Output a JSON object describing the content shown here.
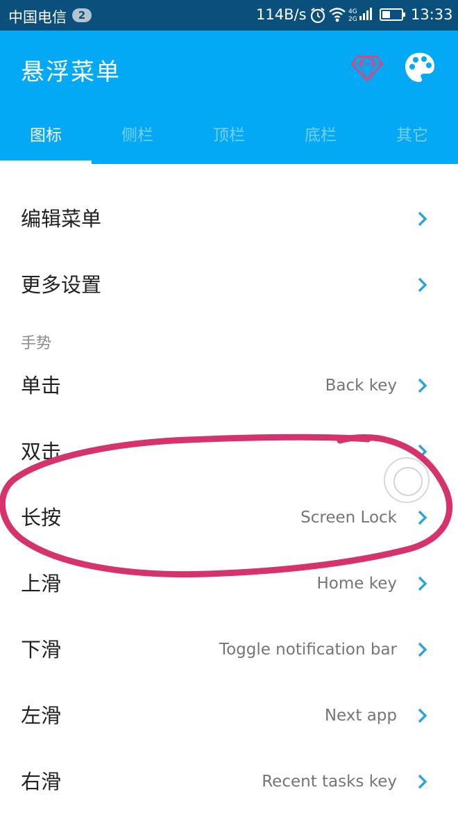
{
  "status_bar": {
    "carrier": "中国电信",
    "notification_count": "2",
    "net_speed": "114B/s",
    "time": "13:33"
  },
  "app_bar": {
    "title": "悬浮菜单",
    "tabs": [
      "图标",
      "侧栏",
      "顶栏",
      "底栏",
      "其它"
    ],
    "active_tab": "图标"
  },
  "menu": {
    "edit_menu": "编辑菜单",
    "more_settings": "更多设置"
  },
  "gestures": {
    "section_title": "手势",
    "items": [
      {
        "label": "单击",
        "value": "Back key"
      },
      {
        "label": "双击",
        "value": ""
      },
      {
        "label": "长按",
        "value": "Screen Lock"
      },
      {
        "label": "上滑",
        "value": "Home key"
      },
      {
        "label": "下滑",
        "value": "Toggle notification bar"
      },
      {
        "label": "左滑",
        "value": "Next app"
      },
      {
        "label": "右滑",
        "value": "Recent tasks key"
      }
    ]
  },
  "icons": {
    "diamond": "diamond-icon",
    "palette": "palette-icon",
    "chevron": "chevron-right-icon"
  },
  "colors": {
    "status_bar": "#0b4f7c",
    "app_bar": "#03a9f4",
    "chevron": "#2aa4e0",
    "annotation": "#d6336c",
    "diamond": "#e0457a"
  }
}
